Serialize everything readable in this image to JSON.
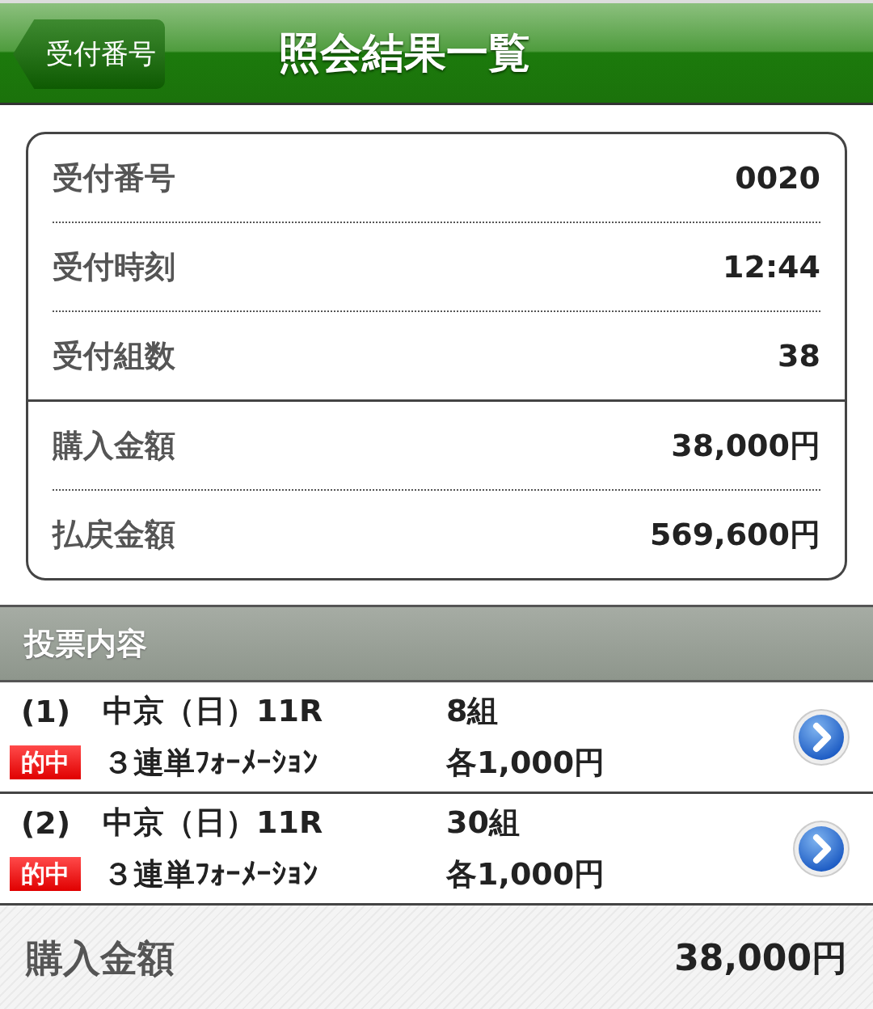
{
  "header": {
    "back_button": "受付番号",
    "title": "照会結果一覧"
  },
  "summary": {
    "sections": [
      {
        "rows": [
          {
            "label": "受付番号",
            "value": "0020"
          },
          {
            "label": "受付時刻",
            "value": "12:44"
          },
          {
            "label": "受付組数",
            "value": "38"
          }
        ]
      },
      {
        "rows": [
          {
            "label": "購入金額",
            "value": "38,000円"
          },
          {
            "label": "払戻金額",
            "value": "569,600円"
          }
        ]
      }
    ]
  },
  "bets": {
    "heading": "投票内容",
    "items": [
      {
        "number": "(1)",
        "race": "中京（日）11R",
        "badge": "的中",
        "bet_type": "３連単ﾌｫｰﾒｰｼｮﾝ",
        "combinations": "8組",
        "unit": "各1,000円"
      },
      {
        "number": "(2)",
        "race": "中京（日）11R",
        "badge": "的中",
        "bet_type": "３連単ﾌｫｰﾒｰｼｮﾝ",
        "combinations": "30組",
        "unit": "各1,000円"
      }
    ]
  },
  "footer": {
    "label": "購入金額",
    "value": "38,000円"
  }
}
